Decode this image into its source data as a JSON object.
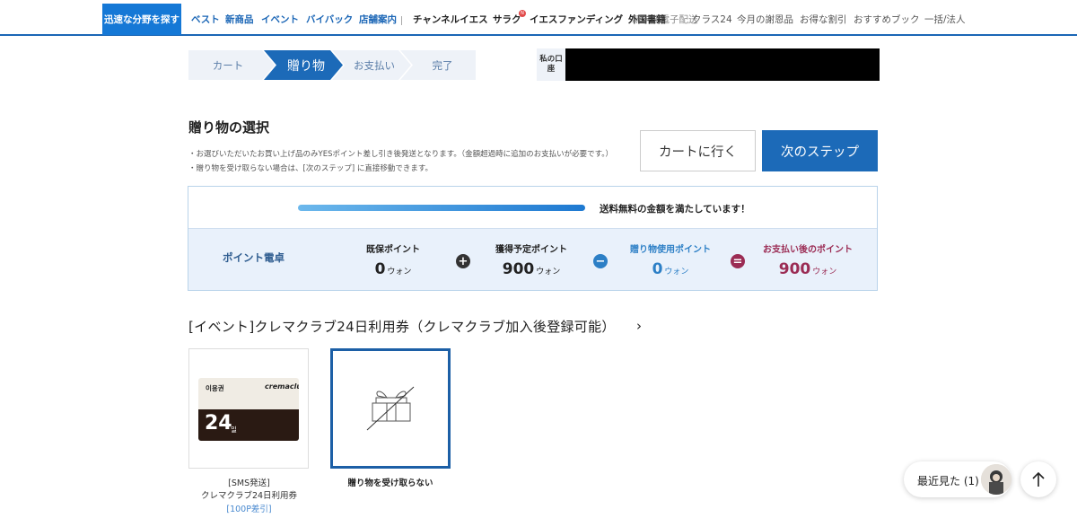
{
  "nav": {
    "primary": "迅速な分野を探す",
    "blue_items": [
      "ベスト",
      "新商品",
      "イベント",
      "バイバック",
      "店舗案内"
    ],
    "dark_items": [
      "チャンネルイエス",
      "サラク",
      "イエスファンディング",
      "外国書籍"
    ],
    "grey_items": [
      "新学期電子配送",
      "クラス24",
      "今月の謝恩品",
      "お得な割引",
      "おすすめブック",
      "一括/法人"
    ],
    "new_badge": "N"
  },
  "steps": [
    "カート",
    "贈り物",
    "お支払い",
    "完了"
  ],
  "account_label": "私の口座",
  "heading": "贈り物の選択",
  "notes": [
    "・お選びいただいたお買い上げ品のみYESポイント差し引き後発送となります。（金額超過時に追加のお支払いが必要です。）",
    "・贈り物を受け取らない場合は、[次のステップ] に直接移動できます。"
  ],
  "buttons": {
    "cart": "カートに行く",
    "next": "次のステップ"
  },
  "shipping_msg": "送料無料の金額を満たしています！",
  "shipping_progress": 1.0,
  "calc_label": "ポイント電卓",
  "points": [
    {
      "title": "既保ポイント",
      "value": "0",
      "unit": "ウォン",
      "color": "#222222"
    },
    {
      "title": "獲得予定ポイント",
      "value": "900",
      "unit": "ウォン",
      "color": "#222222"
    },
    {
      "title": "贈り物使用ポイント",
      "value": "0",
      "unit": "ウォン",
      "color": "#2c7fc6"
    },
    {
      "title": "お支払い後のポイント",
      "value": "900",
      "unit": "ウォン",
      "color": "#9b2c54"
    }
  ],
  "operators": [
    "+",
    "−",
    "="
  ],
  "event_title": "[イベント]クレマクラブ24日利用券（クレマクラブ加入後登録可能）",
  "event_chevron": "›",
  "gift1": {
    "coupon_label": "이용권",
    "coupon_brand": "cremaclub",
    "coupon_num": "24",
    "coupon_unit": "일",
    "caption_line1": "[SMS発送]",
    "caption_line2": "クレマクラブ24日利用券",
    "price": "[100P差引]"
  },
  "gift2": {
    "caption": "贈り物を受け取らない"
  },
  "recent": {
    "label": "最近見た (1)"
  },
  "colors": {
    "accent": "#1c6ab8",
    "nav_blue": "#1b66b6"
  }
}
